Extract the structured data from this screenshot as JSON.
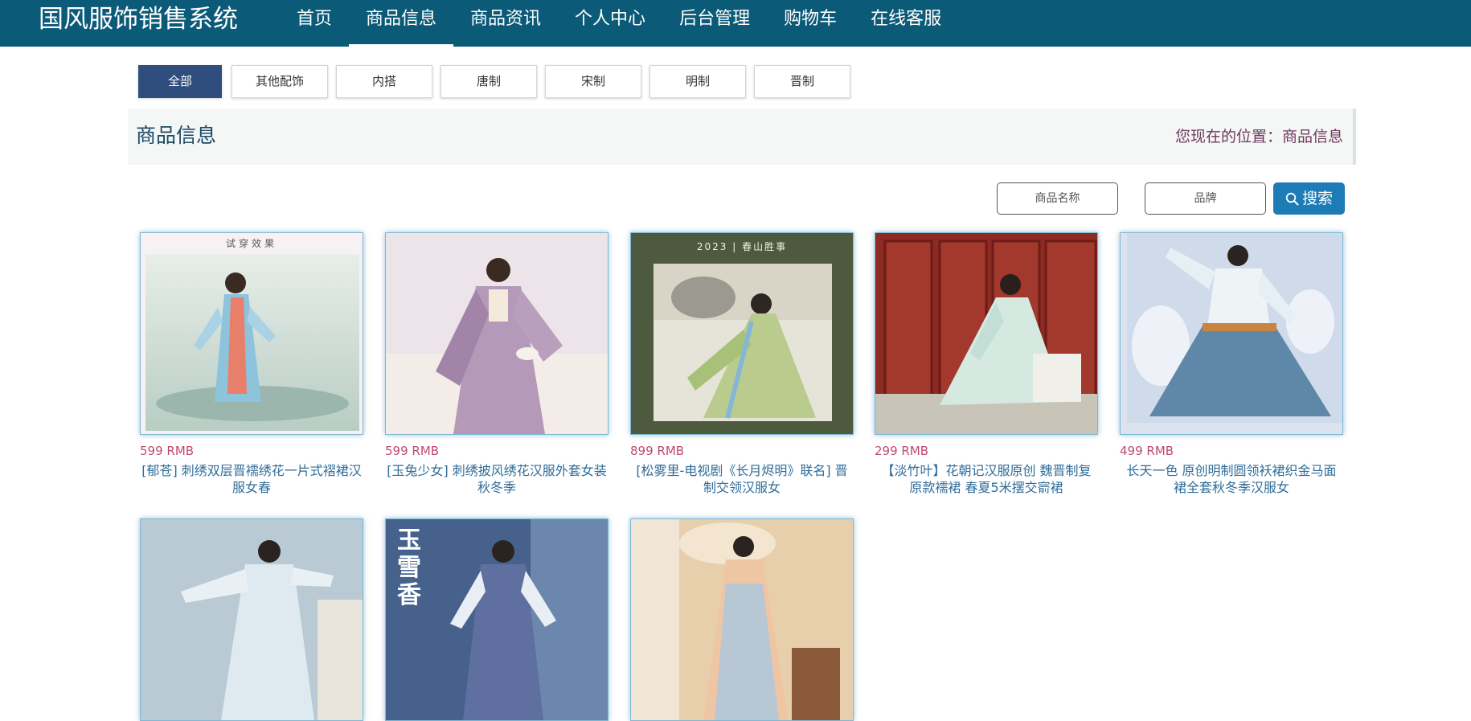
{
  "header": {
    "brand": "国风服饰销售系统",
    "nav": [
      {
        "label": "首页",
        "active": false
      },
      {
        "label": "商品信息",
        "active": true
      },
      {
        "label": "商品资讯",
        "active": false
      },
      {
        "label": "个人中心",
        "active": false
      },
      {
        "label": "后台管理",
        "active": false
      },
      {
        "label": "购物车",
        "active": false
      },
      {
        "label": "在线客服",
        "active": false
      }
    ]
  },
  "categories": [
    {
      "label": "全部",
      "active": true
    },
    {
      "label": "其他配饰",
      "active": false
    },
    {
      "label": "内搭",
      "active": false
    },
    {
      "label": "唐制",
      "active": false
    },
    {
      "label": "宋制",
      "active": false
    },
    {
      "label": "明制",
      "active": false
    },
    {
      "label": "晋制",
      "active": false
    }
  ],
  "page": {
    "title": "商品信息",
    "breadcrumb": "您现在的位置：商品信息"
  },
  "search": {
    "name_placeholder": "商品名称",
    "brand_placeholder": "品牌",
    "button_label": "搜索",
    "button_icon": "search-icon"
  },
  "products": [
    {
      "price": "599 RMB",
      "name": "[郁苍] 刺绣双层晋襦绣花一片式褶裙汉服女春",
      "image_caption": "试穿效果"
    },
    {
      "price": "599 RMB",
      "name": "[玉兔少女] 刺绣披风绣花汉服外套女装秋冬季"
    },
    {
      "price": "899 RMB",
      "name": "[松雾里-电视剧《长月烬明》联名] 晋制交领汉服女",
      "image_caption": "2023 | 春山胜事"
    },
    {
      "price": "299 RMB",
      "name": "【淡竹叶】花朝记汉服原创 魏晋制复原款襦裙 春夏5米摆交窬裙"
    },
    {
      "price": "499 RMB",
      "name": "长天一色 原创明制圆领袄裙织金马面裙全套秋冬季汉服女"
    },
    {
      "price": "",
      "name": ""
    },
    {
      "price": "",
      "name": "",
      "image_caption": "玉雪香"
    },
    {
      "price": "",
      "name": ""
    }
  ],
  "colors": {
    "topbar": "#0b5a78",
    "active_category": "#2f4e7e",
    "search_button": "#1d7bb5",
    "price": "#c14a6e",
    "product_name": "#2f6d99"
  }
}
